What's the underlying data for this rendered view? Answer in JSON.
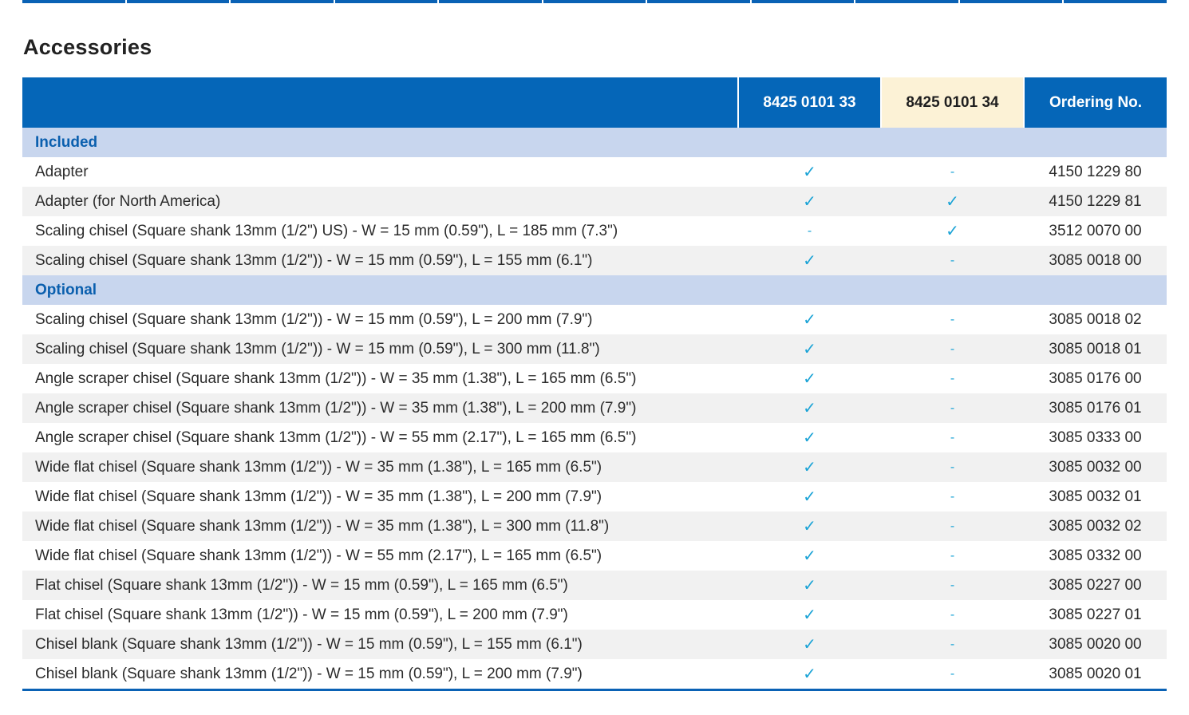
{
  "section": {
    "title": "Accessories"
  },
  "table": {
    "headers": {
      "description": "",
      "model_a": "8425 0101 33",
      "model_b": "8425 0101 34",
      "ordering": "Ordering No."
    },
    "groups": [
      {
        "label": "Included",
        "rows": [
          {
            "desc": "Adapter",
            "a": "✓",
            "b": "-",
            "ord": "4150 1229 80"
          },
          {
            "desc": "Adapter (for North America)",
            "a": "✓",
            "b": "✓",
            "ord": "4150 1229 81"
          },
          {
            "desc": "Scaling chisel (Square shank 13mm (1/2\") US) - W = 15 mm (0.59\"), L = 185 mm (7.3\")",
            "a": "-",
            "b": "✓",
            "ord": "3512 0070 00"
          },
          {
            "desc": "Scaling chisel (Square shank 13mm (1/2\")) - W = 15 mm (0.59\"), L = 155 mm (6.1\")",
            "a": "✓",
            "b": "-",
            "ord": "3085 0018 00"
          }
        ]
      },
      {
        "label": "Optional",
        "rows": [
          {
            "desc": "Scaling chisel (Square shank 13mm (1/2\")) - W = 15 mm (0.59\"), L = 200 mm (7.9\")",
            "a": "✓",
            "b": "-",
            "ord": "3085 0018 02"
          },
          {
            "desc": "Scaling chisel (Square shank 13mm (1/2\")) - W = 15 mm (0.59\"), L = 300 mm (11.8\")",
            "a": "✓",
            "b": "-",
            "ord": "3085 0018 01"
          },
          {
            "desc": "Angle scraper chisel (Square shank 13mm (1/2\")) - W = 35 mm (1.38\"), L = 165 mm (6.5\")",
            "a": "✓",
            "b": "-",
            "ord": "3085 0176 00"
          },
          {
            "desc": "Angle scraper chisel (Square shank 13mm (1/2\")) - W = 35 mm (1.38\"), L = 200 mm (7.9\")",
            "a": "✓",
            "b": "-",
            "ord": "3085 0176 01"
          },
          {
            "desc": "Angle scraper chisel (Square shank 13mm (1/2\")) - W = 55 mm (2.17\"), L = 165 mm (6.5\")",
            "a": "✓",
            "b": "-",
            "ord": "3085 0333 00"
          },
          {
            "desc": "Wide flat chisel (Square shank 13mm (1/2\")) - W = 35 mm (1.38\"), L = 165 mm (6.5\")",
            "a": "✓",
            "b": "-",
            "ord": "3085 0032 00"
          },
          {
            "desc": "Wide flat chisel (Square shank 13mm (1/2\")) - W = 35 mm (1.38\"), L = 200 mm (7.9\")",
            "a": "✓",
            "b": "-",
            "ord": "3085 0032 01"
          },
          {
            "desc": "Wide flat chisel (Square shank 13mm (1/2\")) - W = 35 mm (1.38\"), L = 300 mm (11.8\")",
            "a": "✓",
            "b": "-",
            "ord": "3085 0032 02"
          },
          {
            "desc": "Wide flat chisel (Square shank 13mm (1/2\")) - W = 55 mm (2.17\"), L = 165 mm (6.5\")",
            "a": "✓",
            "b": "-",
            "ord": "3085 0332 00"
          },
          {
            "desc": "Flat chisel (Square shank 13mm (1/2\")) - W = 15 mm (0.59\"), L = 165 mm (6.5\")",
            "a": "✓",
            "b": "-",
            "ord": "3085 0227 00"
          },
          {
            "desc": "Flat chisel (Square shank 13mm (1/2\")) - W = 15 mm (0.59\"), L = 200 mm (7.9\")",
            "a": "✓",
            "b": "-",
            "ord": "3085 0227 01"
          },
          {
            "desc": "Chisel blank (Square shank 13mm (1/2\")) - W = 15 mm (0.59\"), L = 155 mm (6.1\")",
            "a": "✓",
            "b": "-",
            "ord": "3085 0020 00"
          },
          {
            "desc": "Chisel blank (Square shank 13mm (1/2\")) - W = 15 mm (0.59\"), L = 200 mm (7.9\")",
            "a": "✓",
            "b": "-",
            "ord": "3085 0020 01"
          }
        ]
      }
    ]
  },
  "colors": {
    "header_blue": "#0566b8",
    "header_highlight": "#fcf2d6",
    "group_band": "#c8d6ee",
    "group_text": "#0a5fae",
    "row_stripe": "#f1f1f1",
    "check_color": "#1aa3d6"
  }
}
